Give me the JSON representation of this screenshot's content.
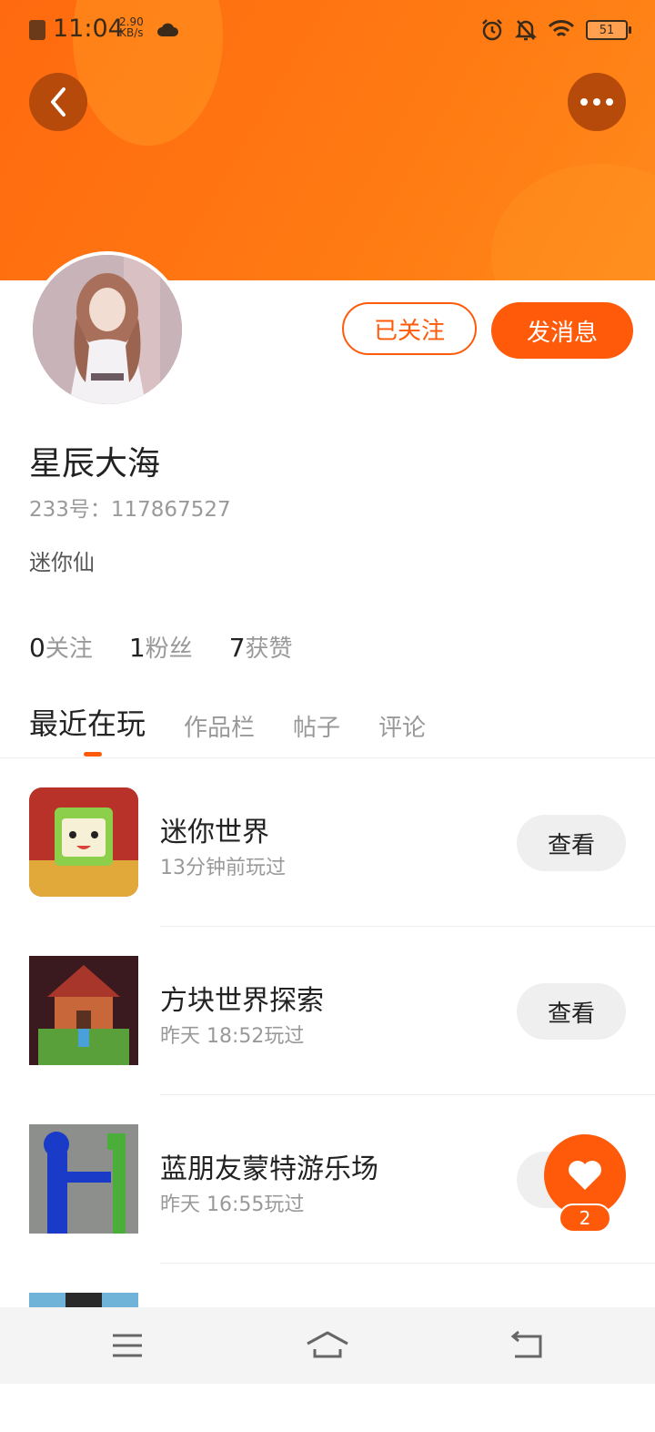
{
  "status_bar": {
    "time": "11:04",
    "speed_value": "2.90",
    "speed_unit": "KB/s",
    "battery": "51"
  },
  "header": {
    "back_icon": "chevron-left-icon",
    "more_icon": "more-dots-icon",
    "accent_color": "#ff5a0a"
  },
  "profile": {
    "follow_label": "已关注",
    "message_label": "发消息",
    "name": "星辰大海",
    "uid": "233号：117867527",
    "bio": "迷你仙",
    "stats": [
      {
        "num": "0",
        "label": "关注"
      },
      {
        "num": "1",
        "label": "粉丝"
      },
      {
        "num": "7",
        "label": "获赞"
      }
    ]
  },
  "tabs": [
    "最近在玩",
    "作品栏",
    "帖子",
    "评论"
  ],
  "games": [
    {
      "name": "迷你世界",
      "time": "13分钟前玩过",
      "button": "查看"
    },
    {
      "name": "方块世界探索",
      "time": "昨天 18:52玩过",
      "button": "查看"
    },
    {
      "name": "蓝朋友蒙特游乐场",
      "time": "昨天 16:55玩过",
      "button": "查看"
    }
  ],
  "fab": {
    "icon": "heart-icon",
    "count": "2"
  },
  "nav": {
    "items": [
      "menu-icon",
      "home-icon",
      "back-icon"
    ]
  }
}
